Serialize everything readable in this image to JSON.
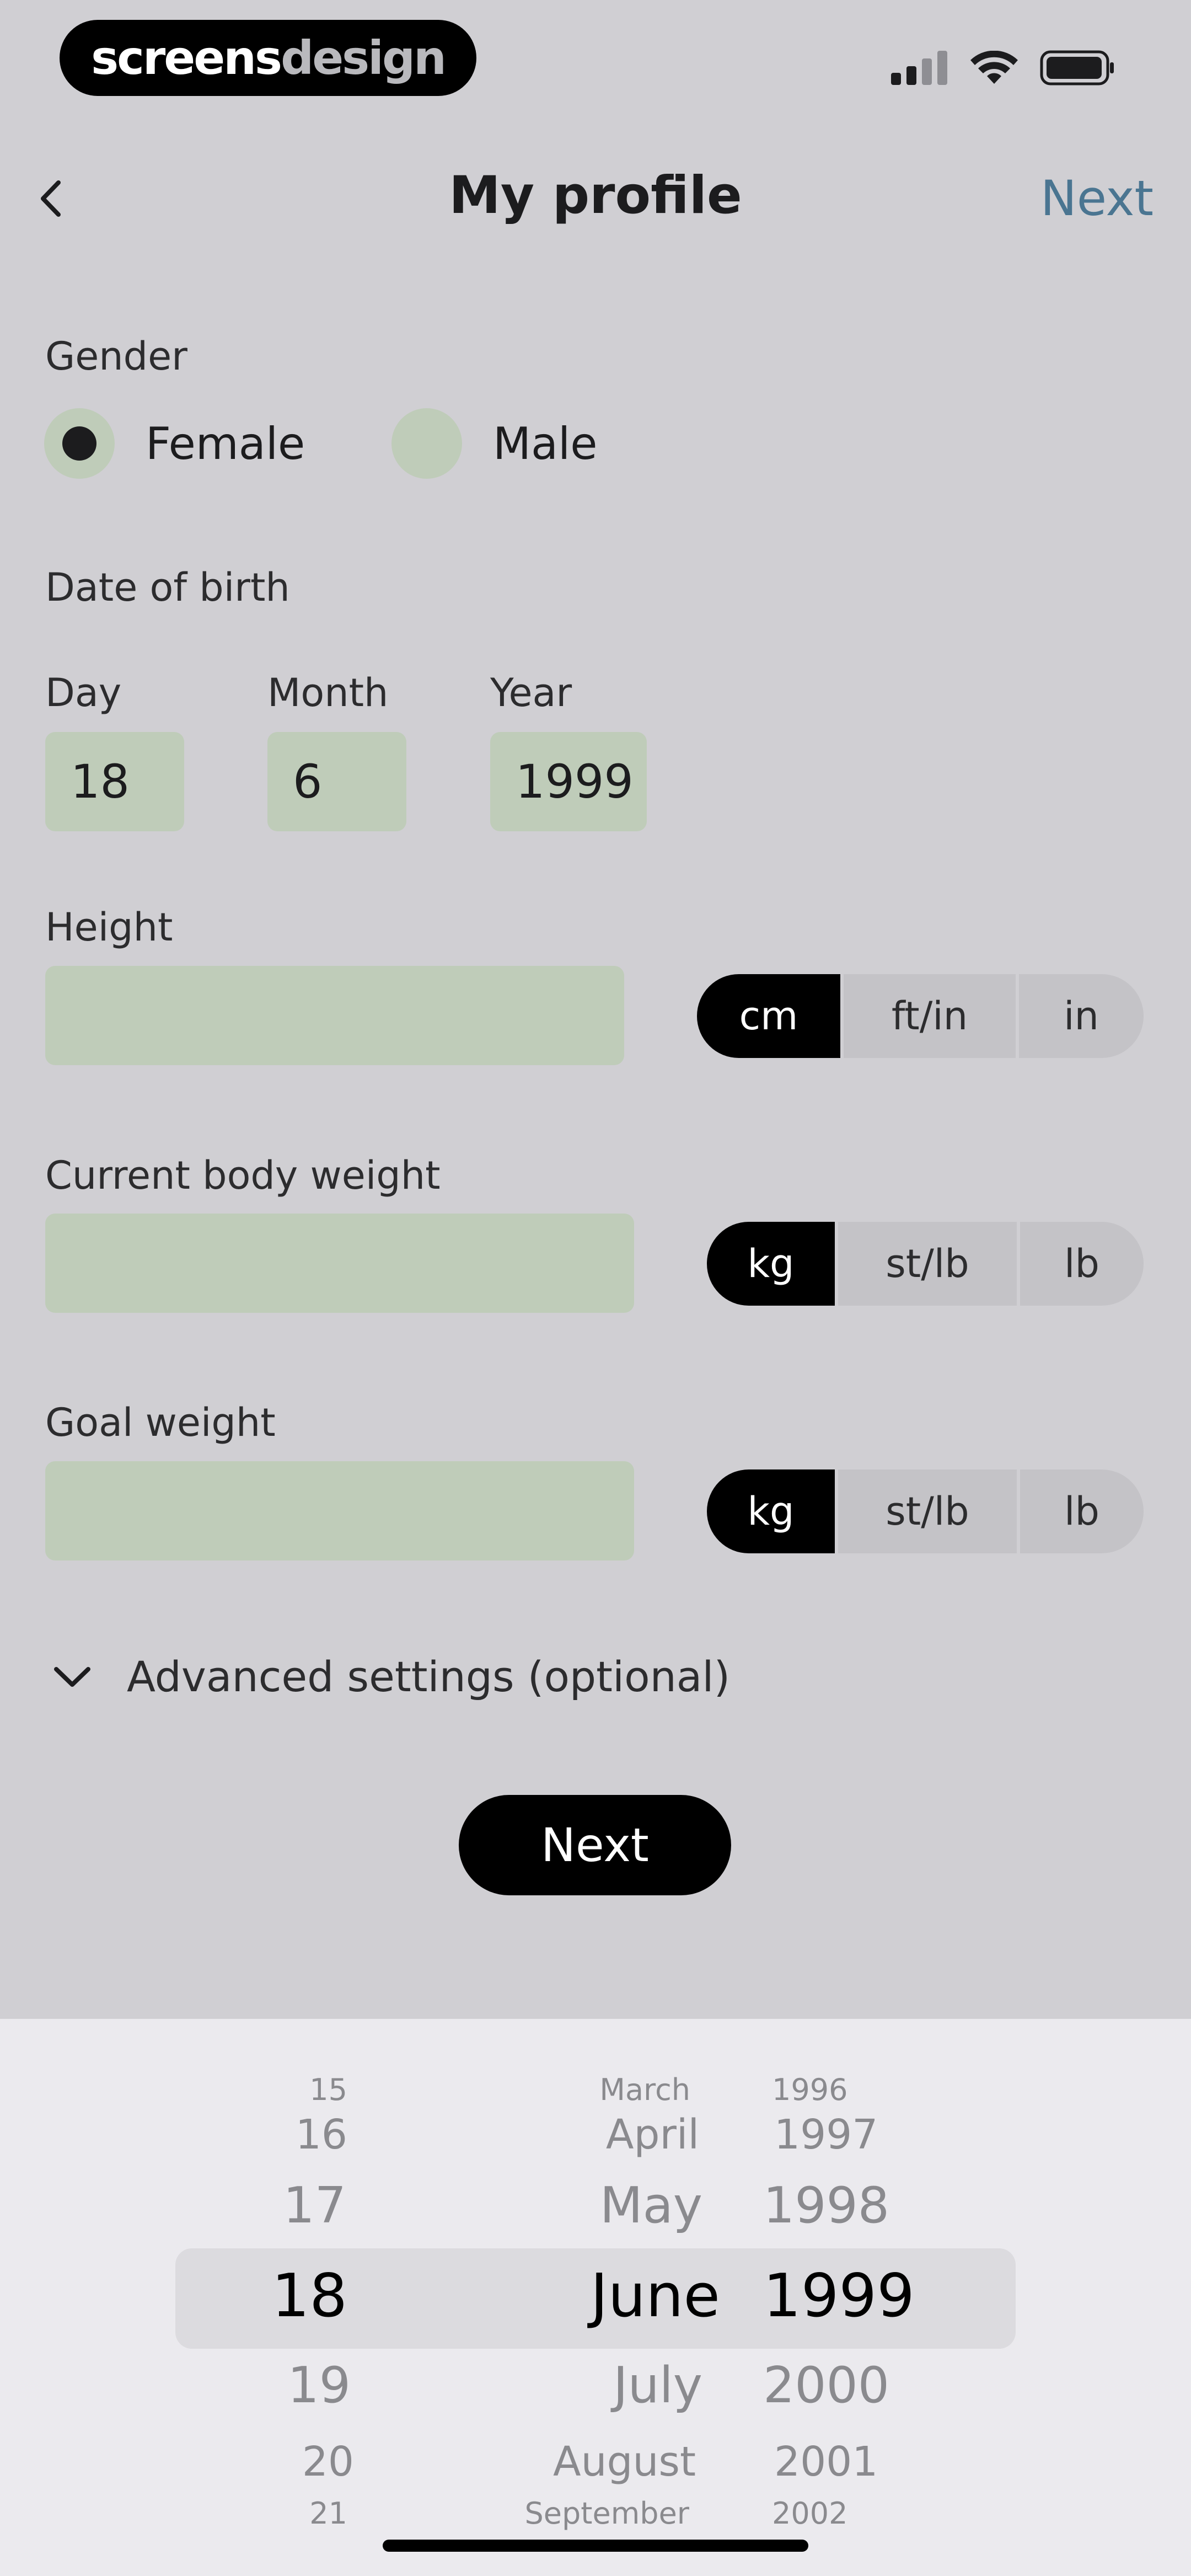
{
  "brand": {
    "part1": "screens",
    "part2": "design"
  },
  "header": {
    "title": "My profile",
    "next_label": "Next"
  },
  "gender": {
    "label": "Gender",
    "options": [
      "Female",
      "Male"
    ],
    "selected": "Female"
  },
  "dob": {
    "label": "Date of birth",
    "day": {
      "label": "Day",
      "value": "18"
    },
    "month": {
      "label": "Month",
      "value": "6"
    },
    "year": {
      "label": "Year",
      "value": "1999"
    }
  },
  "height": {
    "label": "Height",
    "value": "",
    "units": [
      "cm",
      "ft/in",
      "in"
    ],
    "active_unit": "cm"
  },
  "current_weight": {
    "label": "Current body weight",
    "value": "",
    "units": [
      "kg",
      "st/lb",
      "lb"
    ],
    "active_unit": "kg"
  },
  "goal_weight": {
    "label": "Goal weight",
    "value": "",
    "units": [
      "kg",
      "st/lb",
      "lb"
    ],
    "active_unit": "kg"
  },
  "advanced": {
    "label": "Advanced settings (optional)"
  },
  "next_button": {
    "label": "Next"
  },
  "picker": {
    "days": [
      "15",
      "16",
      "17",
      "18",
      "19",
      "20",
      "21"
    ],
    "months": [
      "March",
      "April",
      "May",
      "June",
      "July",
      "August",
      "September"
    ],
    "years": [
      "1996",
      "1997",
      "1998",
      "1999",
      "2000",
      "2001",
      "2002"
    ],
    "selected": {
      "day": "18",
      "month": "June",
      "year": "1999"
    }
  },
  "colors": {
    "accent_link": "#4a7591",
    "field_green": "#bfccb9",
    "background": "#d0cfd3"
  }
}
